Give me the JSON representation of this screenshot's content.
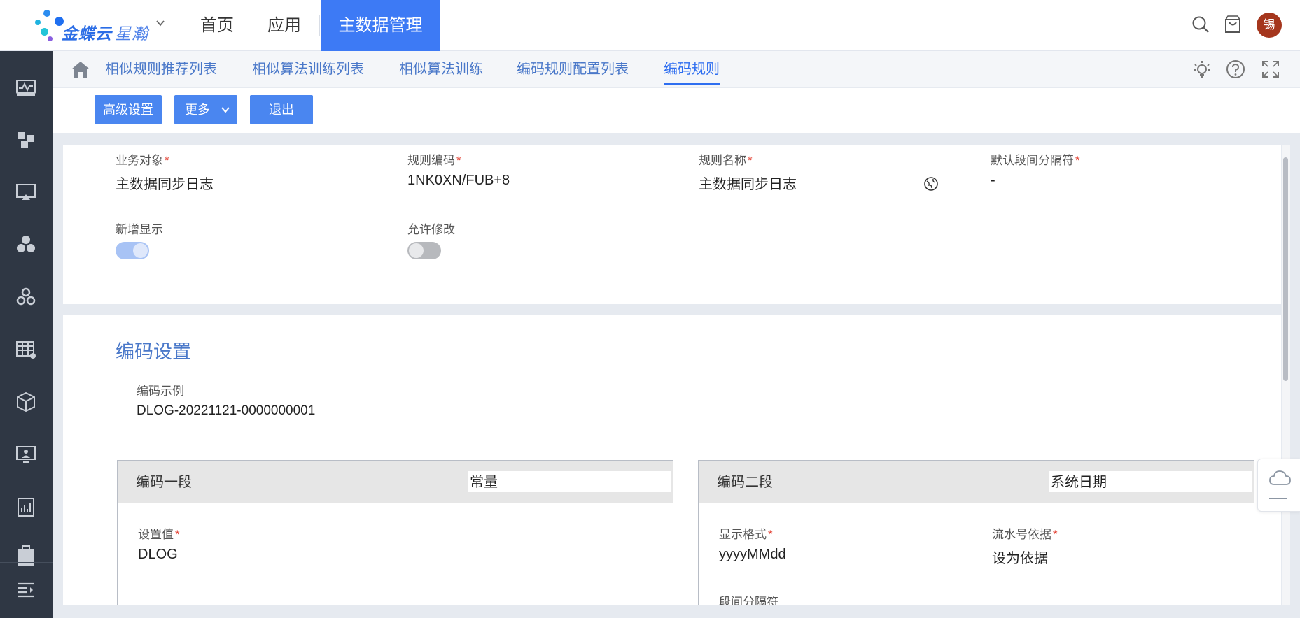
{
  "brand": {
    "name": "金蝶云",
    "product": "星瀚"
  },
  "nav": {
    "items": [
      {
        "label": "首页"
      },
      {
        "label": "应用"
      },
      {
        "label": "主数据管理"
      }
    ],
    "active_index": 2,
    "accent_color": "#3d7af5"
  },
  "header_icons": [
    "search-icon",
    "shopping-bag-icon"
  ],
  "user": {
    "avatar_text": "锡"
  },
  "sidebar": {
    "icons": [
      "monitor-chart-icon",
      "puzzle-icon",
      "screen-cast-icon",
      "circles-icon",
      "gears-icon",
      "table-icon",
      "cube-icon",
      "presentation-icon",
      "report-icon",
      "clipboard-icon"
    ],
    "bottom_icon": "menu-expand-icon"
  },
  "tabs": {
    "items": [
      {
        "label": "相似规则推荐列表"
      },
      {
        "label": "相似算法训练列表"
      },
      {
        "label": "相似算法训练"
      },
      {
        "label": "编码规则配置列表"
      },
      {
        "label": "编码规则"
      }
    ],
    "active_index": 4,
    "tools": [
      "lightbulb-icon",
      "help-icon",
      "fullscreen-icon"
    ]
  },
  "toolbar": {
    "advanced_label": "高级设置",
    "more_label": "更多",
    "exit_label": "退出"
  },
  "form": {
    "business_object": {
      "label": "业务对象",
      "value": "主数据同步日志",
      "required": true
    },
    "rule_code": {
      "label": "规则编码",
      "value": "1NK0XN/FUB+8",
      "required": true
    },
    "rule_name": {
      "label": "规则名称",
      "value": "主数据同步日志",
      "required": true,
      "icon": "globe-icon"
    },
    "default_separator": {
      "label": "默认段间分隔符",
      "value": "-",
      "required": true
    },
    "show_on_add": {
      "label": "新增显示",
      "on": true
    },
    "allow_modify": {
      "label": "允许修改",
      "on": false
    }
  },
  "coding": {
    "section_title": "编码设置",
    "example_label": "编码示例",
    "example_value": "DLOG-20221121-0000000001",
    "segments": [
      {
        "title": "编码一段",
        "type": "常量",
        "fields": [
          {
            "label": "设置值",
            "value": "DLOG",
            "required": true
          }
        ]
      },
      {
        "title": "编码二段",
        "type": "系统日期",
        "fields": [
          {
            "label": "显示格式",
            "value": "yyyyMMdd",
            "required": true
          },
          {
            "label": "流水号依据",
            "value": "设为依据",
            "required": true
          },
          {
            "label": "段间分隔符",
            "value": "",
            "required": false
          }
        ]
      }
    ]
  },
  "floating": {
    "icon": "cloud-icon"
  }
}
